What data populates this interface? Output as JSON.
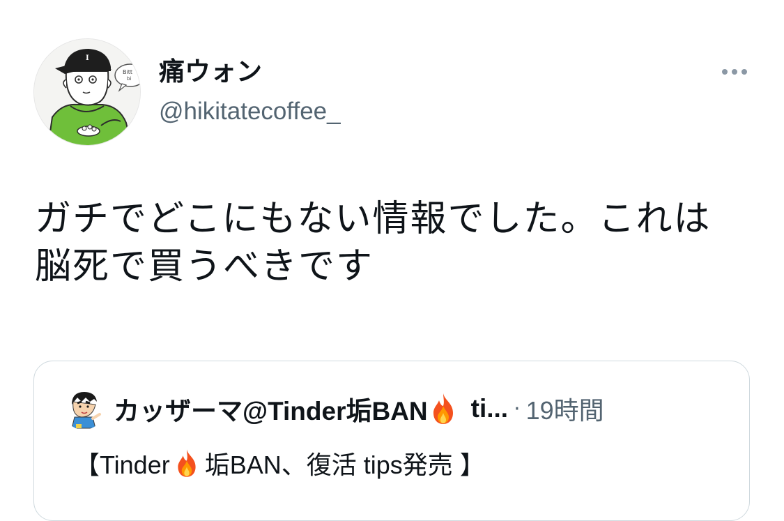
{
  "author": {
    "display_name": "痛ウォン",
    "handle": "@hikitatecoffee_",
    "avatar_icon": "cartoon-person-avatar"
  },
  "tweet": {
    "text": "ガチでどこにもない情報でした。これは脳死で買うべきです"
  },
  "quote": {
    "author_name": "カッザーマ@Tinder垢BAN",
    "author_name_trailing": "ti...",
    "separator": "·",
    "time": "19時間",
    "text_prefix": "【Tinder",
    "text_suffix": "垢BAN、復活 tips発売 】",
    "avatar_icon": "cartoon-boy-avatar",
    "emoji_icon": "fire-icon"
  },
  "colors": {
    "primary_text": "#0f1419",
    "secondary_text": "#536471",
    "border": "#cfd9de",
    "hoodie_green": "#6fbf3a"
  }
}
